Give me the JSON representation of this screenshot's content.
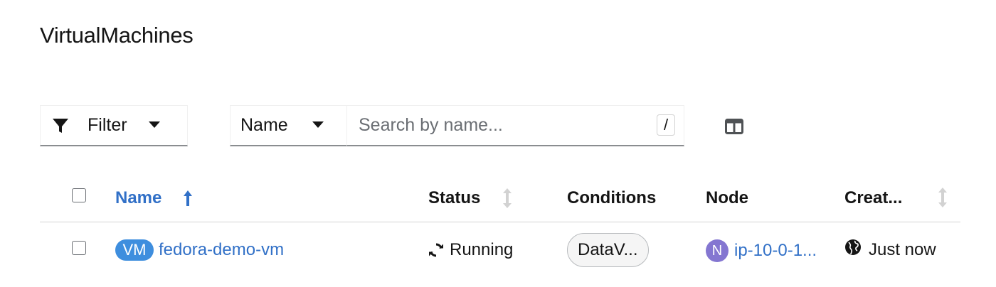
{
  "page": {
    "title": "VirtualMachines"
  },
  "toolbar": {
    "filter_label": "Filter",
    "attribute_label": "Name",
    "search_placeholder": "Search by name...",
    "search_value": "",
    "keyboard_hint": "/",
    "columns_icon": "columns-icon",
    "filter_icon": "filter-icon"
  },
  "table": {
    "columns": {
      "name": "Name",
      "status": "Status",
      "conditions": "Conditions",
      "node": "Node",
      "created": "Creat..."
    },
    "sort": {
      "column": "Name",
      "direction": "ascending"
    },
    "rows": [
      {
        "kind_badge": "VM",
        "name": "fedora-demo-vm",
        "status": "Running",
        "status_icon": "sync-icon",
        "conditions": "DataV...",
        "node_badge": "N",
        "node": "ip-10-0-1...",
        "created_icon": "globe-icon",
        "created": "Just now"
      }
    ]
  },
  "colors": {
    "link": "#3170c7",
    "vm_badge": "#3e8ede",
    "node_badge": "#8476d1",
    "text": "#151515",
    "border": "#d2d2d2"
  }
}
